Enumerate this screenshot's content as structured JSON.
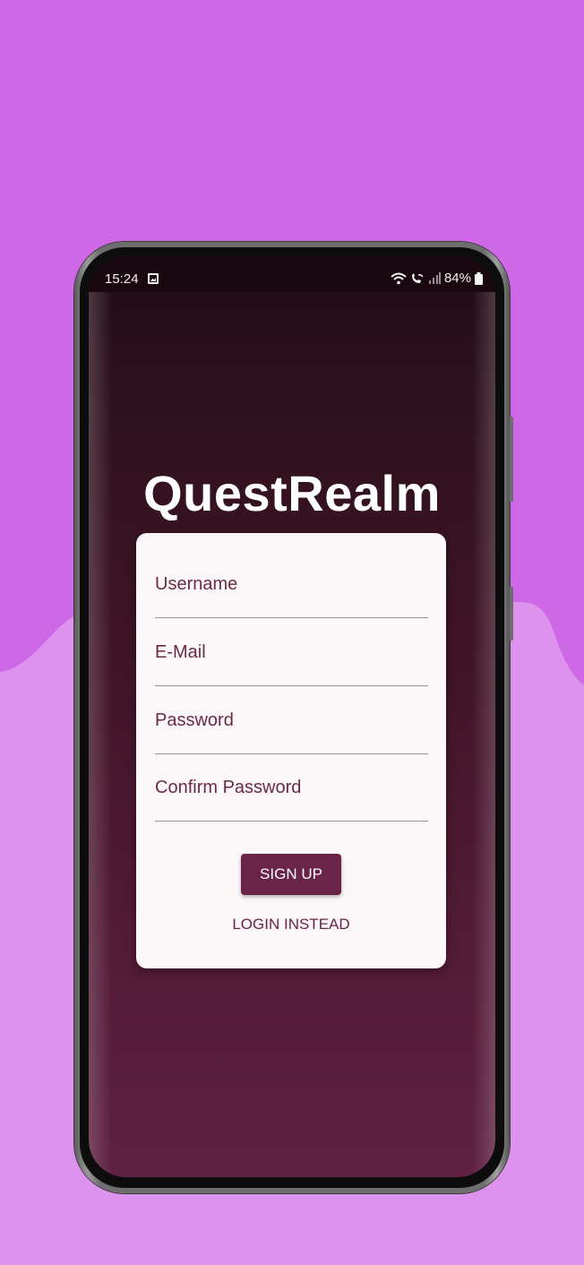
{
  "colors": {
    "background": "#cf68e6",
    "background_wave": "#dd92ee",
    "screen_top": "#220c17",
    "screen_bottom": "#5f2042",
    "card": "#fbf7f9",
    "accent": "#6a2447"
  },
  "status_bar": {
    "time": "15:24",
    "battery": "84%",
    "icons": [
      "image-icon",
      "wifi-icon",
      "wifi-call-icon",
      "signal-icon",
      "battery-icon"
    ]
  },
  "app": {
    "title": "QuestRealm"
  },
  "form": {
    "username_placeholder": "Username",
    "email_placeholder": "E-Mail",
    "password_placeholder": "Password",
    "confirm_password_placeholder": "Confirm Password",
    "signup_label": "SIGN UP",
    "login_label": "LOGIN INSTEAD"
  }
}
